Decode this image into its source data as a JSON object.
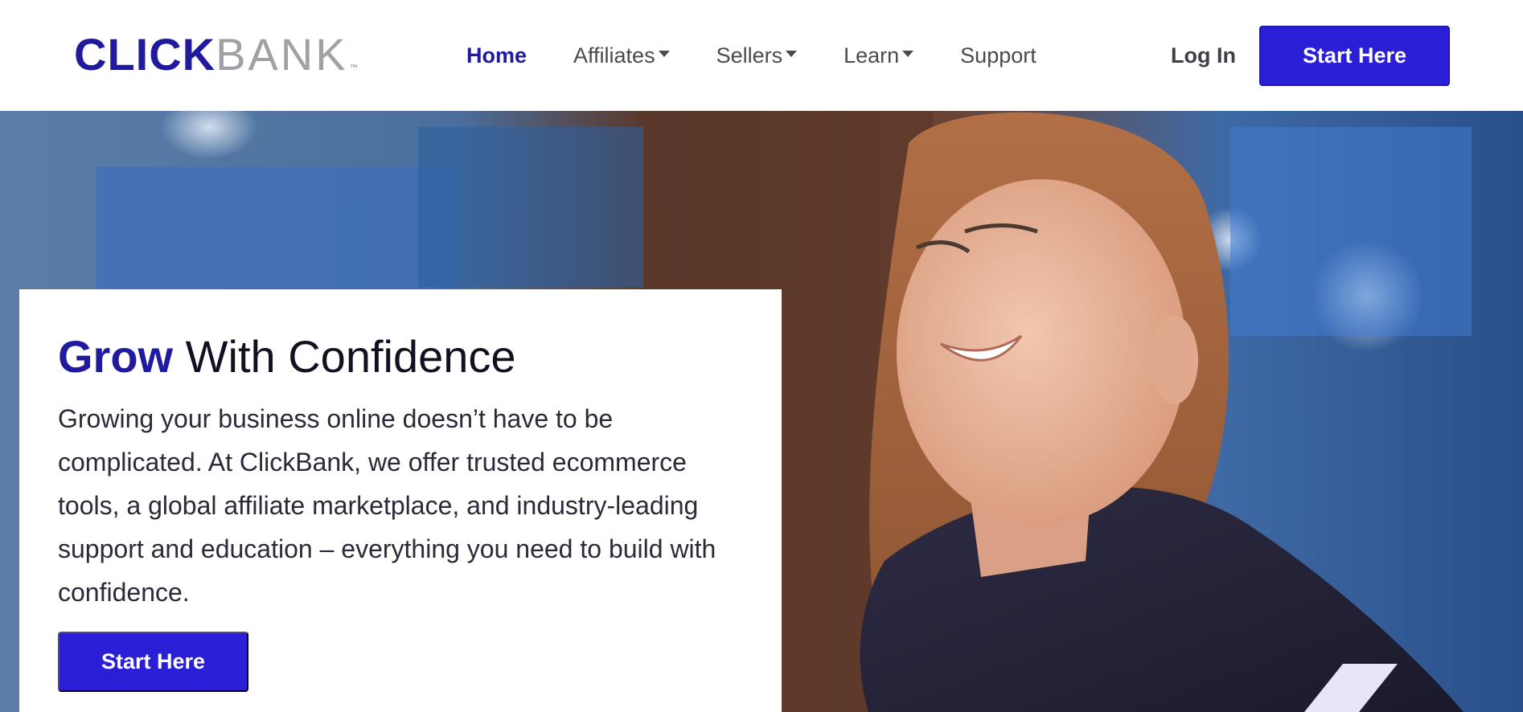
{
  "brand": {
    "logo_primary": "CLICK",
    "logo_secondary": "BANK",
    "logo_tm": "™",
    "accent_color": "#1f1a9e",
    "button_color": "#2a1fd6"
  },
  "nav": {
    "items": [
      {
        "label": "Home",
        "active": true,
        "dropdown": false
      },
      {
        "label": "Affiliates",
        "active": false,
        "dropdown": true
      },
      {
        "label": "Sellers",
        "active": false,
        "dropdown": true
      },
      {
        "label": "Learn",
        "active": false,
        "dropdown": true
      },
      {
        "label": "Support",
        "active": false,
        "dropdown": false
      }
    ],
    "login_label": "Log In",
    "cta_label": "Start Here"
  },
  "hero": {
    "title_accent": "Grow",
    "title_rest": " With Confidence",
    "body": "Growing your business online doesn’t have to be complicated. At ClickBank, we offer trusted ecommerce tools, a global affiliate marketplace, and industry-leading support and education – everything you need to build with confidence.",
    "cta_label": "Start Here"
  }
}
